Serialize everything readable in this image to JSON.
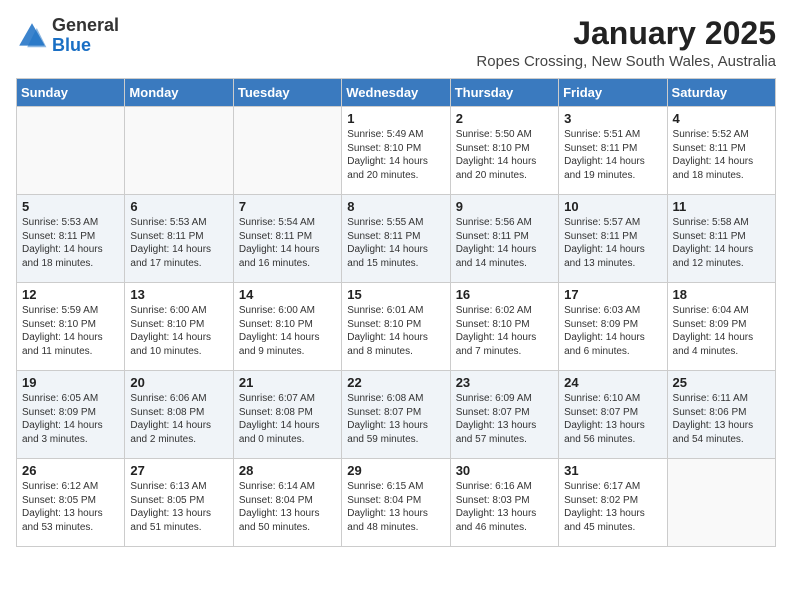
{
  "header": {
    "logo_general": "General",
    "logo_blue": "Blue",
    "month_title": "January 2025",
    "location": "Ropes Crossing, New South Wales, Australia"
  },
  "weekdays": [
    "Sunday",
    "Monday",
    "Tuesday",
    "Wednesday",
    "Thursday",
    "Friday",
    "Saturday"
  ],
  "weeks": [
    [
      {
        "num": "",
        "info": ""
      },
      {
        "num": "",
        "info": ""
      },
      {
        "num": "",
        "info": ""
      },
      {
        "num": "1",
        "info": "Sunrise: 5:49 AM\nSunset: 8:10 PM\nDaylight: 14 hours\nand 20 minutes."
      },
      {
        "num": "2",
        "info": "Sunrise: 5:50 AM\nSunset: 8:10 PM\nDaylight: 14 hours\nand 20 minutes."
      },
      {
        "num": "3",
        "info": "Sunrise: 5:51 AM\nSunset: 8:11 PM\nDaylight: 14 hours\nand 19 minutes."
      },
      {
        "num": "4",
        "info": "Sunrise: 5:52 AM\nSunset: 8:11 PM\nDaylight: 14 hours\nand 18 minutes."
      }
    ],
    [
      {
        "num": "5",
        "info": "Sunrise: 5:53 AM\nSunset: 8:11 PM\nDaylight: 14 hours\nand 18 minutes."
      },
      {
        "num": "6",
        "info": "Sunrise: 5:53 AM\nSunset: 8:11 PM\nDaylight: 14 hours\nand 17 minutes."
      },
      {
        "num": "7",
        "info": "Sunrise: 5:54 AM\nSunset: 8:11 PM\nDaylight: 14 hours\nand 16 minutes."
      },
      {
        "num": "8",
        "info": "Sunrise: 5:55 AM\nSunset: 8:11 PM\nDaylight: 14 hours\nand 15 minutes."
      },
      {
        "num": "9",
        "info": "Sunrise: 5:56 AM\nSunset: 8:11 PM\nDaylight: 14 hours\nand 14 minutes."
      },
      {
        "num": "10",
        "info": "Sunrise: 5:57 AM\nSunset: 8:11 PM\nDaylight: 14 hours\nand 13 minutes."
      },
      {
        "num": "11",
        "info": "Sunrise: 5:58 AM\nSunset: 8:11 PM\nDaylight: 14 hours\nand 12 minutes."
      }
    ],
    [
      {
        "num": "12",
        "info": "Sunrise: 5:59 AM\nSunset: 8:10 PM\nDaylight: 14 hours\nand 11 minutes."
      },
      {
        "num": "13",
        "info": "Sunrise: 6:00 AM\nSunset: 8:10 PM\nDaylight: 14 hours\nand 10 minutes."
      },
      {
        "num": "14",
        "info": "Sunrise: 6:00 AM\nSunset: 8:10 PM\nDaylight: 14 hours\nand 9 minutes."
      },
      {
        "num": "15",
        "info": "Sunrise: 6:01 AM\nSunset: 8:10 PM\nDaylight: 14 hours\nand 8 minutes."
      },
      {
        "num": "16",
        "info": "Sunrise: 6:02 AM\nSunset: 8:10 PM\nDaylight: 14 hours\nand 7 minutes."
      },
      {
        "num": "17",
        "info": "Sunrise: 6:03 AM\nSunset: 8:09 PM\nDaylight: 14 hours\nand 6 minutes."
      },
      {
        "num": "18",
        "info": "Sunrise: 6:04 AM\nSunset: 8:09 PM\nDaylight: 14 hours\nand 4 minutes."
      }
    ],
    [
      {
        "num": "19",
        "info": "Sunrise: 6:05 AM\nSunset: 8:09 PM\nDaylight: 14 hours\nand 3 minutes."
      },
      {
        "num": "20",
        "info": "Sunrise: 6:06 AM\nSunset: 8:08 PM\nDaylight: 14 hours\nand 2 minutes."
      },
      {
        "num": "21",
        "info": "Sunrise: 6:07 AM\nSunset: 8:08 PM\nDaylight: 14 hours\nand 0 minutes."
      },
      {
        "num": "22",
        "info": "Sunrise: 6:08 AM\nSunset: 8:07 PM\nDaylight: 13 hours\nand 59 minutes."
      },
      {
        "num": "23",
        "info": "Sunrise: 6:09 AM\nSunset: 8:07 PM\nDaylight: 13 hours\nand 57 minutes."
      },
      {
        "num": "24",
        "info": "Sunrise: 6:10 AM\nSunset: 8:07 PM\nDaylight: 13 hours\nand 56 minutes."
      },
      {
        "num": "25",
        "info": "Sunrise: 6:11 AM\nSunset: 8:06 PM\nDaylight: 13 hours\nand 54 minutes."
      }
    ],
    [
      {
        "num": "26",
        "info": "Sunrise: 6:12 AM\nSunset: 8:05 PM\nDaylight: 13 hours\nand 53 minutes."
      },
      {
        "num": "27",
        "info": "Sunrise: 6:13 AM\nSunset: 8:05 PM\nDaylight: 13 hours\nand 51 minutes."
      },
      {
        "num": "28",
        "info": "Sunrise: 6:14 AM\nSunset: 8:04 PM\nDaylight: 13 hours\nand 50 minutes."
      },
      {
        "num": "29",
        "info": "Sunrise: 6:15 AM\nSunset: 8:04 PM\nDaylight: 13 hours\nand 48 minutes."
      },
      {
        "num": "30",
        "info": "Sunrise: 6:16 AM\nSunset: 8:03 PM\nDaylight: 13 hours\nand 46 minutes."
      },
      {
        "num": "31",
        "info": "Sunrise: 6:17 AM\nSunset: 8:02 PM\nDaylight: 13 hours\nand 45 minutes."
      },
      {
        "num": "",
        "info": ""
      }
    ]
  ]
}
